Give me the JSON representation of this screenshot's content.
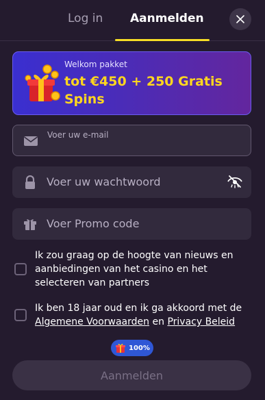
{
  "tabs": {
    "login": "Log in",
    "register": "Aanmelden"
  },
  "banner": {
    "kicker": "Welkom pakket",
    "title": "tot €450 + 250 Gratis Spins"
  },
  "fields": {
    "email_label": "Voer uw e-mail",
    "password_placeholder": "Voer uw wachtwoord",
    "promo_placeholder": "Voer Promo code"
  },
  "checkboxes": {
    "news": "Ik zou graag op de hoogte van nieuws en aanbiedingen van het casino en het selecteren van partners",
    "terms_prefix": "Ik ben 18 jaar oud en ik ga akkoord met de",
    "terms_link": "Algemene Voorwaarden",
    "terms_and": "en",
    "privacy_link": "Privacy Beleid"
  },
  "progress": {
    "value": "100%",
    "fraction": 1.0
  },
  "submit_label": "Aanmelden",
  "colors": {
    "accent": "#f7de26",
    "background": "#241b2e",
    "banner_title": "#ffd61f",
    "badge": "#2f57d6"
  },
  "icons": [
    "close-icon",
    "gift-icon",
    "envelope-icon",
    "lock-icon",
    "eye-off-icon",
    "gift-box-icon"
  ]
}
